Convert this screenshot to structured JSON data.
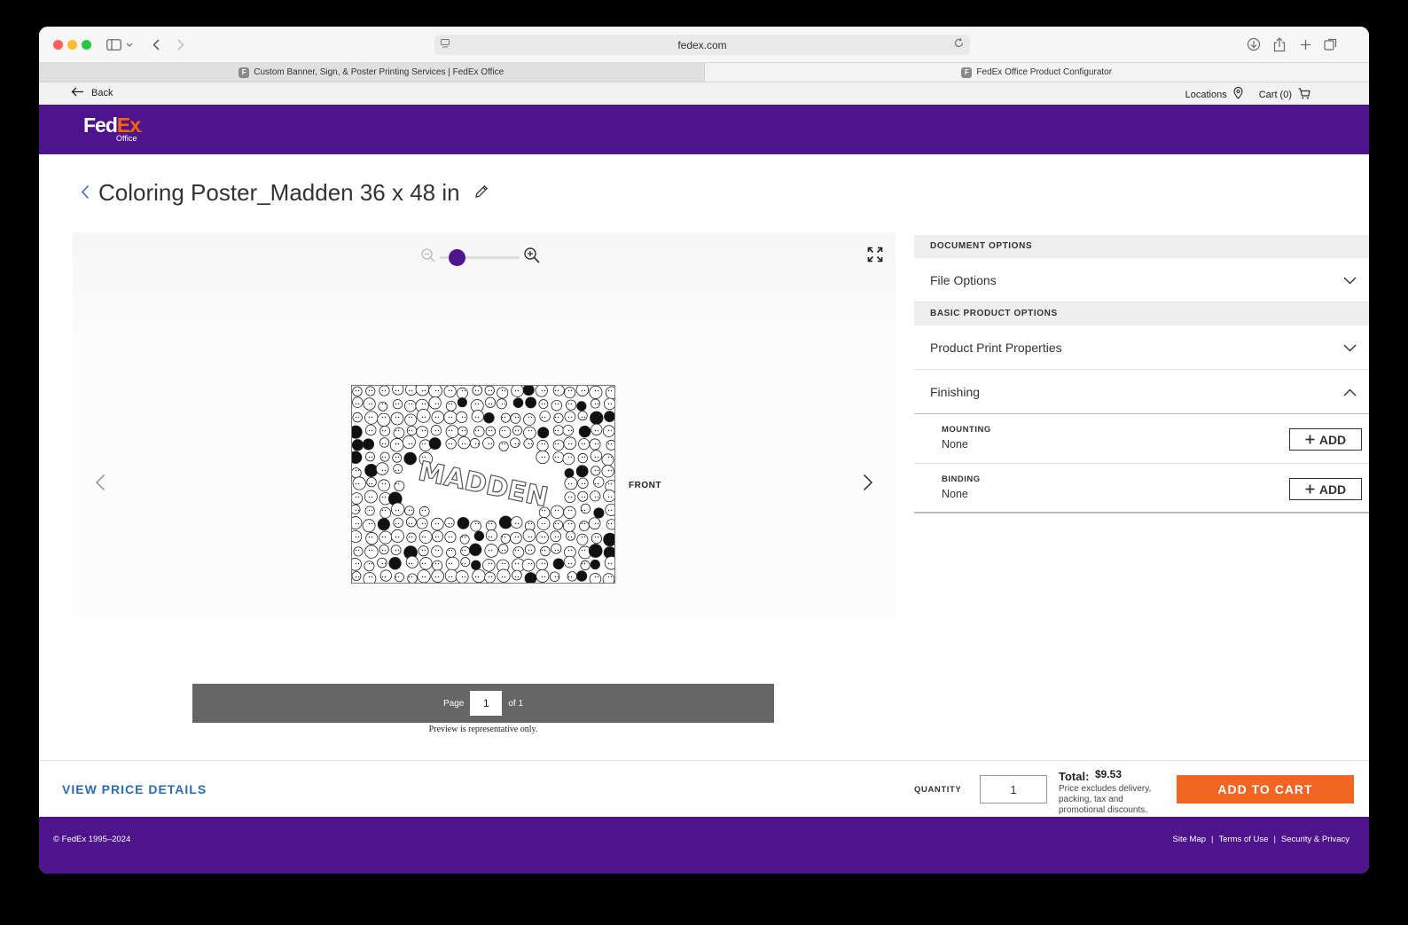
{
  "browser": {
    "url": "fedex.com",
    "tabs": [
      {
        "label": "Custom Banner, Sign, & Poster Printing Services | FedEx Office",
        "favicon": "F"
      },
      {
        "label": "FedEx Office Product Configurator",
        "favicon": "F"
      }
    ]
  },
  "subnav": {
    "back_label": "Back",
    "locations_label": "Locations",
    "cart_label": "Cart (0)"
  },
  "brand": {
    "logo_fed": "Fed",
    "logo_ex": "Ex",
    "logo_sub": "Office",
    "purple": "#4d148c",
    "orange": "#ff6200"
  },
  "product": {
    "title": "Coloring Poster_Madden 36 x 48 in"
  },
  "preview": {
    "side_label": "FRONT",
    "poster_text": "MADDEN",
    "page_label": "Page",
    "page_value": "1",
    "page_of": "of 1",
    "note": "Preview is representative only.",
    "zoom_level": 0.15
  },
  "options": {
    "document_header": "DOCUMENT OPTIONS",
    "file_options_label": "File Options",
    "basic_header": "BASIC PRODUCT OPTIONS",
    "print_properties_label": "Product Print Properties",
    "finishing_label": "Finishing",
    "finishing_items": [
      {
        "label": "MOUNTING",
        "value": "None",
        "button": "ADD"
      },
      {
        "label": "BINDING",
        "value": "None",
        "button": "ADD"
      }
    ]
  },
  "checkout": {
    "price_details_label": "VIEW PRICE DETAILS",
    "quantity_label": "QUANTITY",
    "quantity_value": "1",
    "total_label": "Total:",
    "total_value": "$9.53",
    "total_note": "Price excludes delivery, packing, tax and promotional discounts.",
    "add_to_cart_label": "ADD TO CART",
    "cta_color": "#f26522"
  },
  "footer": {
    "copyright": "© FedEx 1995–2024",
    "links": [
      "Site Map",
      "Terms of Use",
      "Security & Privacy"
    ]
  }
}
